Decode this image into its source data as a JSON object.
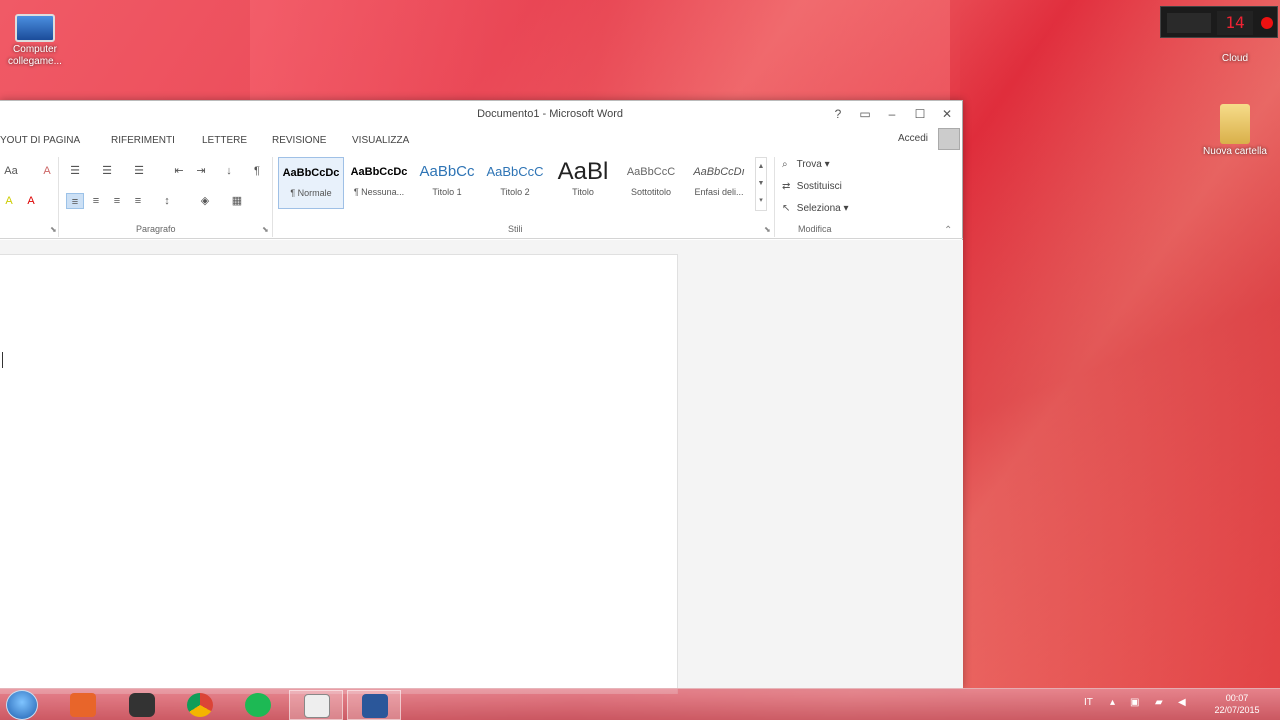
{
  "desktop": {
    "icons": [
      {
        "label": "Computer collegame...",
        "icon": "computer-icon"
      },
      {
        "label": "Cloud",
        "icon": "cloud-icon"
      },
      {
        "label": "Nuova cartella",
        "icon": "folder-icon"
      }
    ],
    "gadget_value": "14"
  },
  "window": {
    "title": "Documento1 - Microsoft Word",
    "buttons": {
      "help": "?",
      "ribbon_options": "▭",
      "minimize": "–",
      "maximize": "☐",
      "close": "✕"
    },
    "tabs": [
      "YOUT DI PAGINA",
      "RIFERIMENTI",
      "LETTERE",
      "REVISIONE",
      "VISUALIZZA"
    ],
    "signin": "Accedi"
  },
  "ribbon": {
    "groups": {
      "paragraph": "Paragrafo",
      "styles": "Stili",
      "editing": "Modifica"
    },
    "font_buttons": {
      "case": "Aa",
      "clear": "A",
      "highlight": "A",
      "fontcolor": "A"
    },
    "paragraph_buttons": {
      "pilcrow": "¶",
      "sort": "↓"
    },
    "styles": [
      {
        "sample": "AaBbCcDc",
        "name": "¶ Normale",
        "selected": true
      },
      {
        "sample": "AaBbCcDc",
        "name": "¶ Nessuna...",
        "selected": false
      },
      {
        "sample": "AaBbCc",
        "name": "Titolo 1",
        "selected": false
      },
      {
        "sample": "AaBbCcC",
        "name": "Titolo 2",
        "selected": false
      },
      {
        "sample": "AaBl",
        "name": "Titolo",
        "selected": false
      },
      {
        "sample": "AaBbCcC",
        "name": "Sottotitolo",
        "selected": false
      },
      {
        "sample": "AaBbCcDı",
        "name": "Enfasi deli...",
        "selected": false
      }
    ],
    "editing": {
      "find": "Trova",
      "replace": "Sostituisci",
      "select": "Seleziona"
    }
  },
  "taskbar": {
    "apps": [
      "power-app-icon",
      "webcam-app-icon",
      "chrome-icon",
      "spotify-icon",
      "notepad-icon",
      "word-icon"
    ],
    "tray_lang": "IT",
    "time": "00:07",
    "date": "22/07/2015"
  }
}
